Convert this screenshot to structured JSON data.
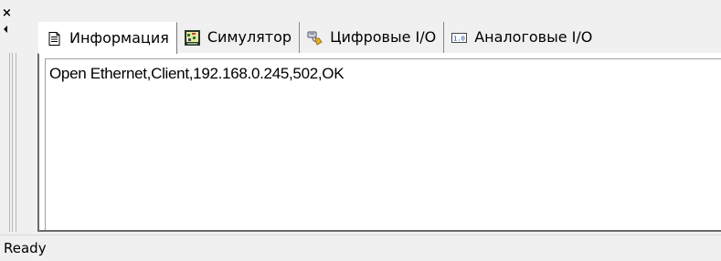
{
  "panel": {
    "close_icon": "×",
    "pin_icon": "pin-left-arrow-icon"
  },
  "tabs": [
    {
      "label": "Информация",
      "icon": "document-icon",
      "active": true
    },
    {
      "label": "Симулятор",
      "icon": "simulator-icon",
      "active": false
    },
    {
      "label": "Цифровые I/O",
      "icon": "digital-io-icon",
      "active": false
    },
    {
      "label": "Аналоговые I/O",
      "icon": "analog-io-icon",
      "active": false
    }
  ],
  "output": {
    "lines": [
      "Open Ethernet,Client,192.168.0.245,502,OK"
    ]
  },
  "statusbar": {
    "text": "Ready"
  },
  "colors": {
    "window_bg": "#f0f0f0",
    "content_bg": "#ffffff",
    "border_dark": "#6a6a6a"
  }
}
